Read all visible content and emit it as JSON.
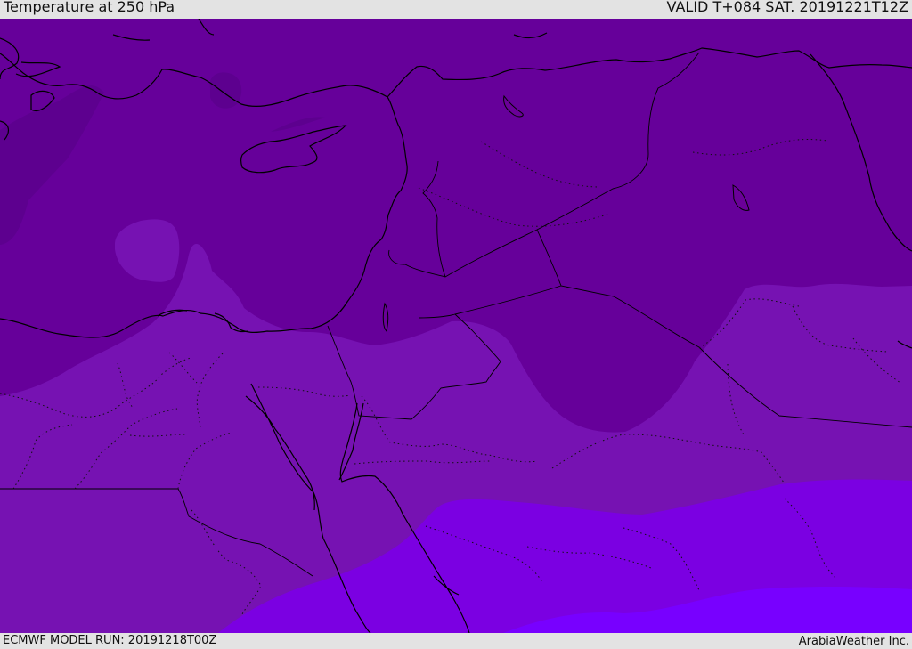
{
  "header": {
    "title": "Temperature at 250 hPa",
    "valid_time": "VALID T+084 SAT. 20191221T12Z"
  },
  "footer": {
    "model_run": "ECMWF MODEL RUN: 20191218T00Z",
    "credit": "ArabiaWeather Inc."
  },
  "map": {
    "colors": {
      "darkest": "#5d008f",
      "dark": "#66009a",
      "medium": "#7612b2",
      "bright": "#7b00e2",
      "brightest": "#7800ff"
    },
    "features": {
      "coastline": "black solid coastline",
      "borders": "black country borders",
      "internal_borders": "dotted internal borders"
    }
  }
}
